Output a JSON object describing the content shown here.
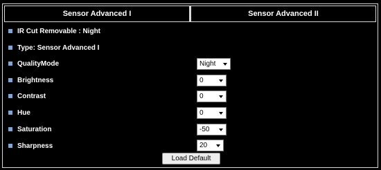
{
  "tabs": [
    "Sensor Advanced I",
    "Sensor Advanced II"
  ],
  "info": {
    "ir_cut": "IR Cut Removable : Night",
    "type": "Type: Sensor Advanced I"
  },
  "settings": [
    {
      "label": "QualityMode",
      "value": "Night"
    },
    {
      "label": "Brightness",
      "value": "0"
    },
    {
      "label": "Contrast",
      "value": "0"
    },
    {
      "label": "Hue",
      "value": "0"
    },
    {
      "label": "Saturation",
      "value": "-50"
    },
    {
      "label": "Sharpness",
      "value": "20"
    }
  ],
  "button": {
    "load_default": "Load Default"
  },
  "colors": {
    "background": "#000000",
    "bullet": "#7ea6d9",
    "border": "#d9d9d9"
  }
}
